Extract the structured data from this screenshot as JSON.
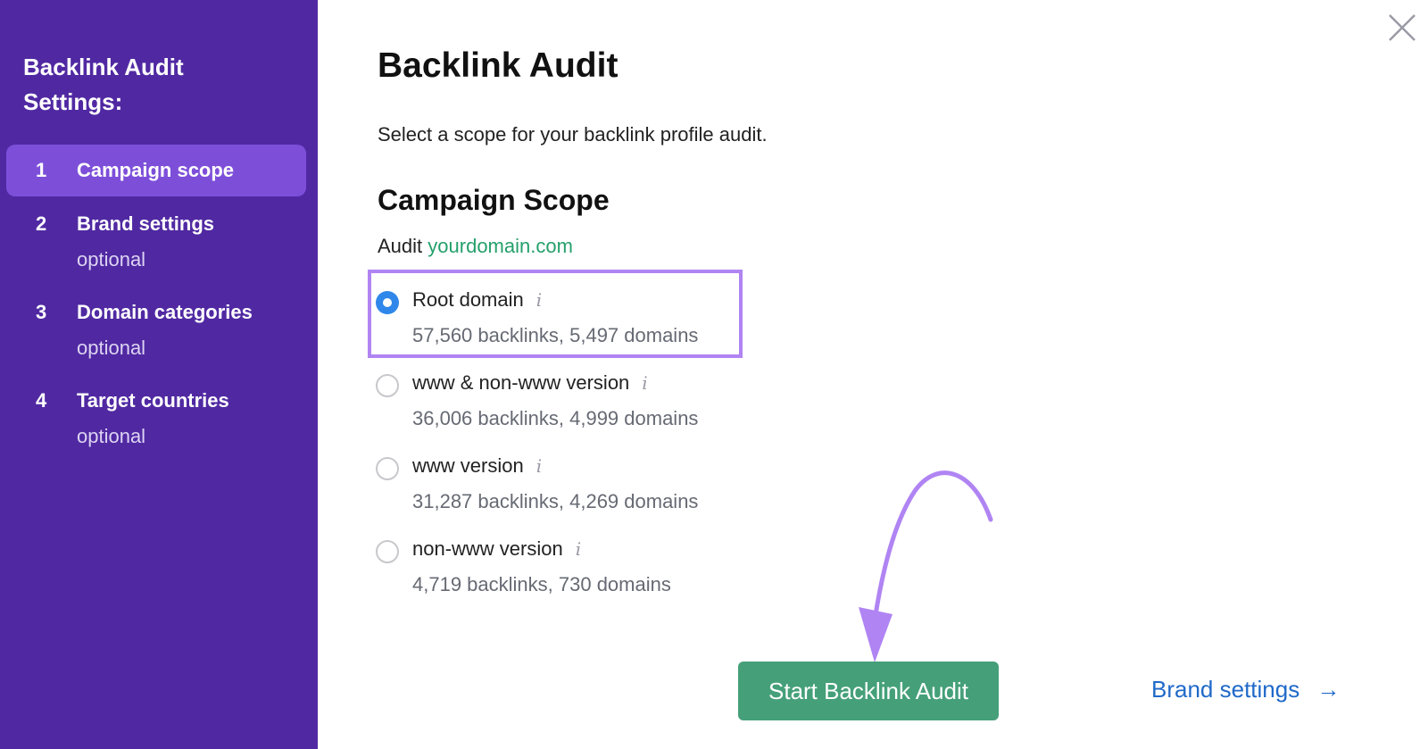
{
  "sidebar": {
    "title_line1": "Backlink Audit",
    "title_line2": "Settings:",
    "steps": [
      {
        "num": "1",
        "label": "Campaign scope",
        "sub": ""
      },
      {
        "num": "2",
        "label": "Brand settings",
        "sub": "optional"
      },
      {
        "num": "3",
        "label": "Domain categories",
        "sub": "optional"
      },
      {
        "num": "4",
        "label": "Target countries",
        "sub": "optional"
      }
    ]
  },
  "main": {
    "title": "Backlink Audit",
    "description": "Select a scope for your backlink profile audit.",
    "section_title": "Campaign Scope",
    "audit_label": "Audit",
    "domain": "yourdomain.com",
    "options": [
      {
        "label": "Root domain",
        "stats": "57,560 backlinks, 5,497 domains",
        "selected": true
      },
      {
        "label": "www & non-www version",
        "stats": "36,006 backlinks, 4,999 domains",
        "selected": false
      },
      {
        "label": "www version",
        "stats": "31,287 backlinks, 4,269 domains",
        "selected": false
      },
      {
        "label": "non-www version",
        "stats": "4,719 backlinks, 730 domains",
        "selected": false
      }
    ],
    "info_glyph": "i",
    "start_button": "Start Backlink Audit",
    "next_link": "Brand settings",
    "next_arrow": "→"
  },
  "colors": {
    "sidebar": "#5029a2",
    "active_step": "#7d4fd9",
    "highlight": "#b084f3",
    "button": "#45a079",
    "link": "#1f69c9",
    "domain": "#25a06b"
  }
}
